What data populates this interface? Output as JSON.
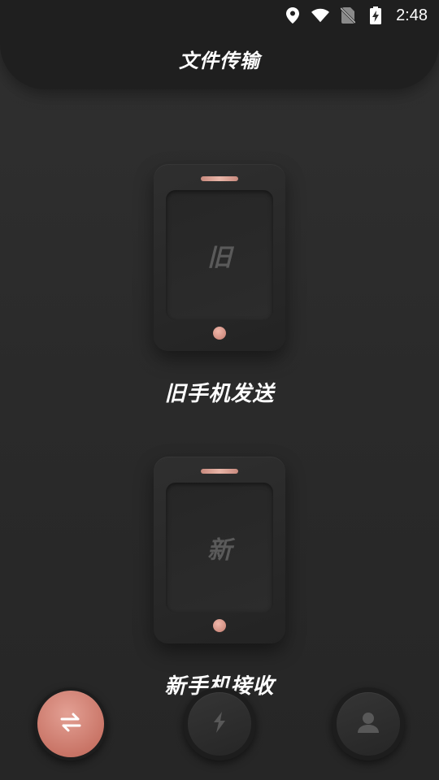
{
  "status_bar": {
    "time": "2:48",
    "icons": [
      "location-icon",
      "wifi-icon",
      "no-sim-icon",
      "battery-charging-icon"
    ]
  },
  "header": {
    "title": "文件传输"
  },
  "old_phone": {
    "screen_label": "旧",
    "caption": "旧手机发送"
  },
  "new_phone": {
    "screen_label": "新",
    "caption": "新手机接收"
  },
  "bottom_nav": {
    "items": [
      {
        "icon": "transfer-arrows-icon",
        "active": true
      },
      {
        "icon": "lightning-icon",
        "active": false
      },
      {
        "icon": "user-icon",
        "active": false
      }
    ]
  },
  "colors": {
    "accent": "#c97567",
    "background": "#2b2b2b",
    "header": "#1f1f1f"
  }
}
